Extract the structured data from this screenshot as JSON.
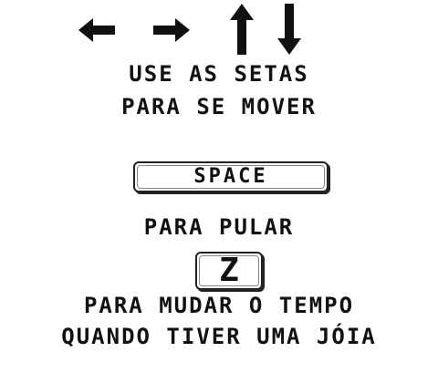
{
  "arrows": {
    "icons": [
      "arrow-left-icon",
      "arrow-right-icon",
      "arrow-up-icon",
      "arrow-down-icon"
    ],
    "color": "#111111"
  },
  "instructions": {
    "move_line1": "USE AS SETAS",
    "move_line2": "PARA SE MOVER",
    "space_key": "SPACE",
    "jump_label": "PARA PULAR",
    "z_key": "Z",
    "time_line1": "PARA MUDAR O TEMPO",
    "time_line2": "QUANDO TIVER UMA JÓIA"
  }
}
